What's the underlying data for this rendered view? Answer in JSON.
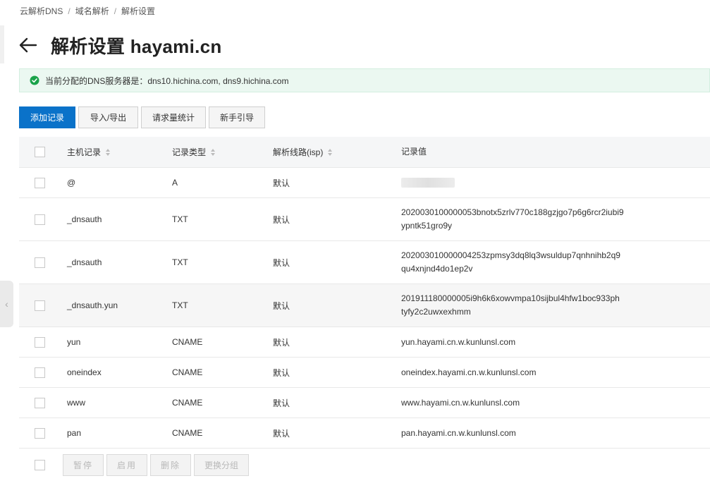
{
  "breadcrumb": {
    "items": [
      "云解析DNS",
      "域名解析",
      "解析设置"
    ]
  },
  "title": "解析设置 hayami.cn",
  "notice": {
    "text": "当前分配的DNS服务器是：dns10.hichina.com, dns9.hichina.com"
  },
  "toolbar": {
    "add": "添加记录",
    "import_export": "导入/导出",
    "stats": "请求量统计",
    "guide": "新手引导"
  },
  "table": {
    "headers": {
      "host": "主机记录",
      "type": "记录类型",
      "line": "解析线路(isp)",
      "value": "记录值"
    },
    "rows": [
      {
        "host": "@",
        "type": "A",
        "line": "默认",
        "value": ""
      },
      {
        "host": "_dnsauth",
        "type": "TXT",
        "line": "默认",
        "value": "2020030100000053bnotx5zrlv770c188gzjgo7p6g6rcr2iubi9",
        "value2": "ypntk51gro9y"
      },
      {
        "host": "_dnsauth",
        "type": "TXT",
        "line": "默认",
        "value": "202003010000004253zpmsy3dq8lq3wsuldup7qnhnihb2q9",
        "value2": "qu4xnjnd4do1ep2v"
      },
      {
        "host": "_dnsauth.yun",
        "type": "TXT",
        "line": "默认",
        "value": "201911180000005i9h6k6xowvmpa10sijbul4hfw1boc933ph",
        "value2": "tyfy2c2uwxexhmm"
      },
      {
        "host": "yun",
        "type": "CNAME",
        "line": "默认",
        "value": "yun.hayami.cn.w.kunlunsl.com"
      },
      {
        "host": "oneindex",
        "type": "CNAME",
        "line": "默认",
        "value": "oneindex.hayami.cn.w.kunlunsl.com"
      },
      {
        "host": "www",
        "type": "CNAME",
        "line": "默认",
        "value": "www.hayami.cn.w.kunlunsl.com"
      },
      {
        "host": "pan",
        "type": "CNAME",
        "line": "默认",
        "value": "pan.hayami.cn.w.kunlunsl.com"
      }
    ]
  },
  "bulk": {
    "pause": "暂停",
    "enable": "启用",
    "delete": "删除",
    "change_group": "更换分组"
  },
  "colors": {
    "primary": "#0a72c9",
    "success": "#1aa34a",
    "notice_bg": "#ebf8f1"
  }
}
